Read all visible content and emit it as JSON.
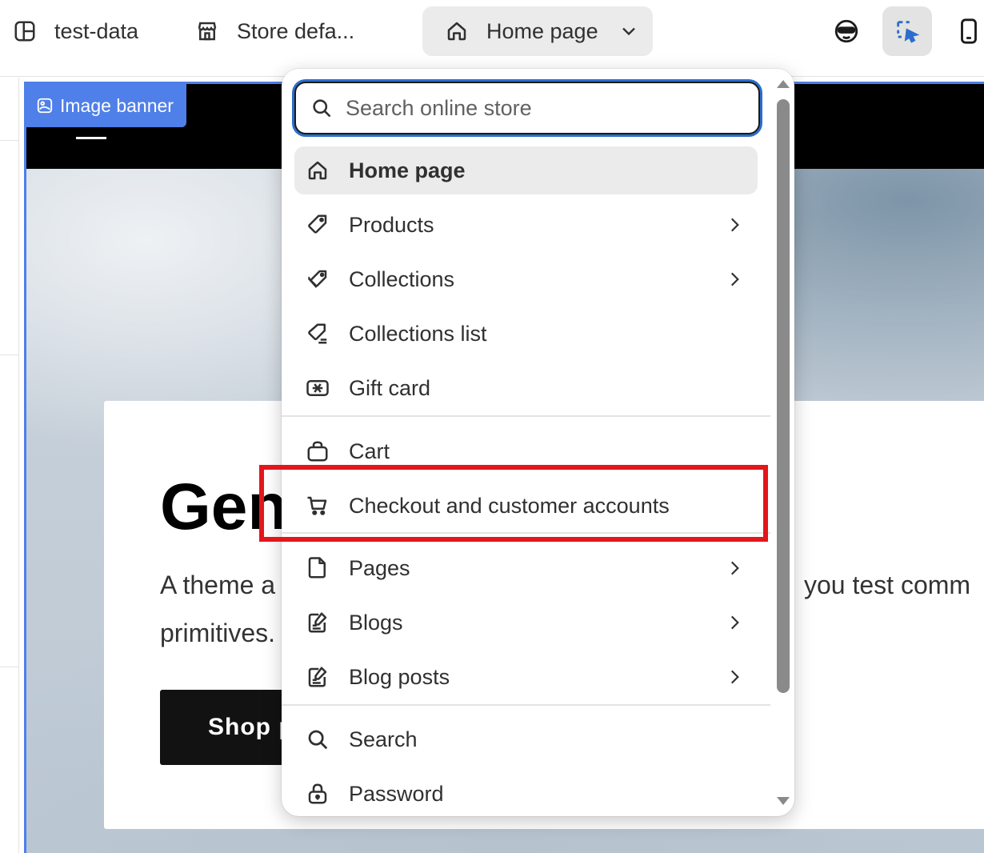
{
  "topbar": {
    "theme_name": "test-data",
    "store_name": "Store defa...",
    "page_selector": "Home page"
  },
  "preview": {
    "section_tag": "Image banner",
    "hero_title": "Gen",
    "hero_text_line1_left": "A theme a",
    "hero_text_line1_right": "you test comm",
    "hero_text_line2": "primitives.",
    "shop_button": "Shop p"
  },
  "dropdown": {
    "search_placeholder": "Search online store",
    "items": [
      {
        "label": "Home page",
        "icon": "home-icon",
        "active": true,
        "has_submenu": false
      },
      {
        "label": "Products",
        "icon": "tag-icon",
        "active": false,
        "has_submenu": true
      },
      {
        "label": "Collections",
        "icon": "tags-icon",
        "active": false,
        "has_submenu": true
      },
      {
        "label": "Collections list",
        "icon": "tag-list-icon",
        "active": false,
        "has_submenu": false
      },
      {
        "label": "Gift card",
        "icon": "gift-card-icon",
        "active": false,
        "has_submenu": false
      },
      {
        "label": "Cart",
        "icon": "bag-icon",
        "active": false,
        "has_submenu": false
      },
      {
        "label": "Checkout and customer accounts",
        "icon": "cart-icon",
        "active": false,
        "has_submenu": false
      },
      {
        "label": "Pages",
        "icon": "page-icon",
        "active": false,
        "has_submenu": true
      },
      {
        "label": "Blogs",
        "icon": "blog-icon",
        "active": false,
        "has_submenu": true
      },
      {
        "label": "Blog posts",
        "icon": "blog-post-icon",
        "active": false,
        "has_submenu": true
      },
      {
        "label": "Search",
        "icon": "search-icon",
        "active": false,
        "has_submenu": false
      },
      {
        "label": "Password",
        "icon": "lock-icon",
        "active": false,
        "has_submenu": false
      }
    ]
  },
  "colors": {
    "selection_outline": "#4f7fe8",
    "highlight_annotation": "#e3161b",
    "focus_ring": "#2c6ecb"
  }
}
